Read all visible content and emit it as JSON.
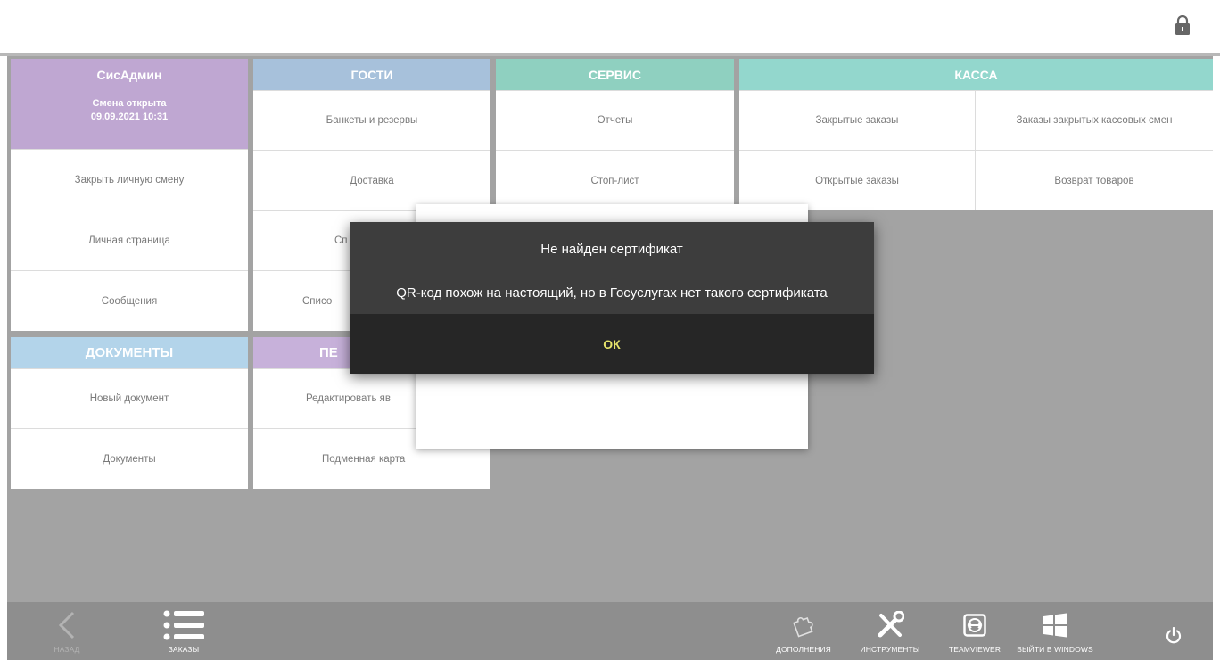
{
  "colors": {
    "purple": "#bfa7d2",
    "blue": "#a7c1db",
    "teal": "#8fd0c0",
    "mint": "#93d7cd",
    "doc_blue": "#b3d4ea",
    "lavender": "#c7b1da",
    "accent_ok": "#e7e46b"
  },
  "topbar": {
    "lock_icon": "lock-icon"
  },
  "sysadmin": {
    "title": "СисАдмин",
    "shift_status": "Смена открыта",
    "shift_time": "09.09.2021 10:31",
    "items": [
      "Закрыть личную смену",
      "Личная страница",
      "Сообщения"
    ]
  },
  "guests": {
    "title": "ГОСТИ",
    "items": [
      "Банкеты и резервы",
      "Доставка",
      "Сп",
      "Списо"
    ]
  },
  "service": {
    "title": "СЕРВИС",
    "items": [
      "Отчеты",
      "Стоп-лист"
    ]
  },
  "kassa": {
    "title": "КАССА",
    "items": [
      "Закрытые заказы",
      "Заказы закрытых кассовых смен",
      "Открытые заказы",
      "Возврат товаров"
    ]
  },
  "documents": {
    "title": "ДОКУМЕНТЫ",
    "items": [
      "Новый документ",
      "Документы"
    ]
  },
  "personnel": {
    "title": "ПЕ",
    "items": [
      "Редактировать яв",
      "Подменная карта"
    ]
  },
  "dialog": {
    "title": "Не найден сертификат",
    "message": "QR-код похож на настоящий, но в Госуслугах нет такого сертификата",
    "ok_label": "ОК"
  },
  "bottombar": {
    "back_label": "НАЗАД",
    "orders_label": "ЗАКАЗЫ",
    "addons_label": "ДОПОЛНЕНИЯ",
    "tools_label": "ИНСТРУМЕНТЫ",
    "teamviewer_label": "TEAMVIEWER",
    "exit_windows_label": "ВЫЙТИ В WINDOWS"
  }
}
